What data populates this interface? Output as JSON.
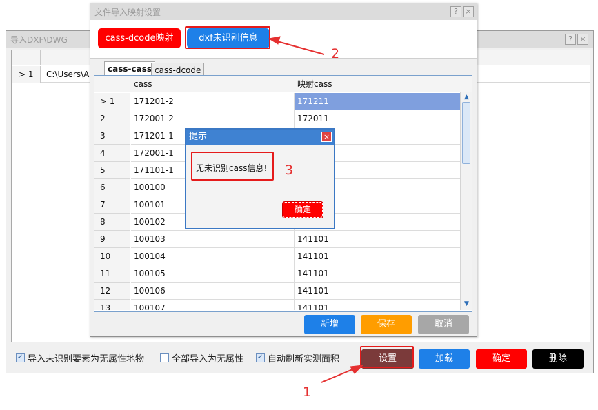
{
  "back_window": {
    "title": "导入DXF\\DWG",
    "help_glyph": "?",
    "close_glyph": "×",
    "grid": {
      "row_number": "1",
      "row_marker": ">",
      "path_value": "C:\\Users\\AiZ"
    },
    "checkboxes": [
      {
        "label": "导入未识别要素为无属性地物",
        "checked": true
      },
      {
        "label": "全部导入为无属性",
        "checked": false
      },
      {
        "label": "自动刷新实测面积",
        "checked": true
      }
    ],
    "buttons": {
      "settings": "设置",
      "load": "加载",
      "confirm": "确定",
      "delete": "删除"
    }
  },
  "mapping_window": {
    "title": "文件导入映射设置",
    "help_glyph": "?",
    "close_glyph": "×",
    "top_buttons": {
      "dcode_mapping": "cass-dcode映射",
      "dxf_unrecognized": "dxf未识别信息"
    },
    "tabs": [
      "cass-cass",
      "cass-dcode"
    ],
    "grid": {
      "columns": [
        "cass",
        "映射cass"
      ],
      "rows": [
        {
          "no": "1",
          "cass": "171201-2",
          "mapped": "171211",
          "selected": true
        },
        {
          "no": "2",
          "cass": "172001-2",
          "mapped": "172011"
        },
        {
          "no": "3",
          "cass": "171201-1",
          "mapped": ""
        },
        {
          "no": "4",
          "cass": "172001-1",
          "mapped": ""
        },
        {
          "no": "5",
          "cass": "171101-1",
          "mapped": ""
        },
        {
          "no": "6",
          "cass": "100100",
          "mapped": ""
        },
        {
          "no": "7",
          "cass": "100101",
          "mapped": ""
        },
        {
          "no": "8",
          "cass": "100102",
          "mapped": ""
        },
        {
          "no": "9",
          "cass": "100103",
          "mapped": "141101"
        },
        {
          "no": "10",
          "cass": "100104",
          "mapped": "141101"
        },
        {
          "no": "11",
          "cass": "100105",
          "mapped": "141101"
        },
        {
          "no": "12",
          "cass": "100106",
          "mapped": "141101"
        },
        {
          "no": "13",
          "cass": "100107",
          "mapped": "141101"
        }
      ]
    },
    "bottom_buttons": {
      "add": "新增",
      "save": "保存",
      "cancel": "取消"
    }
  },
  "dialog": {
    "title": "提示",
    "close_glyph": "×",
    "message": "无未识别cass信息!",
    "ok": "确定"
  },
  "annotations": [
    "1",
    "2",
    "3"
  ],
  "colors": {
    "accent_red": "#ff0000",
    "accent_blue": "#1e80e8",
    "settings_brown": "#7b3a3a",
    "save_orange": "#ff9d00",
    "cancel_gray": "#a7a7a7",
    "delete_black": "#000000",
    "annotation_red": "#e53030",
    "selection_blue": "#7f9fde",
    "dialog_title_blue": "#3f82d2"
  }
}
